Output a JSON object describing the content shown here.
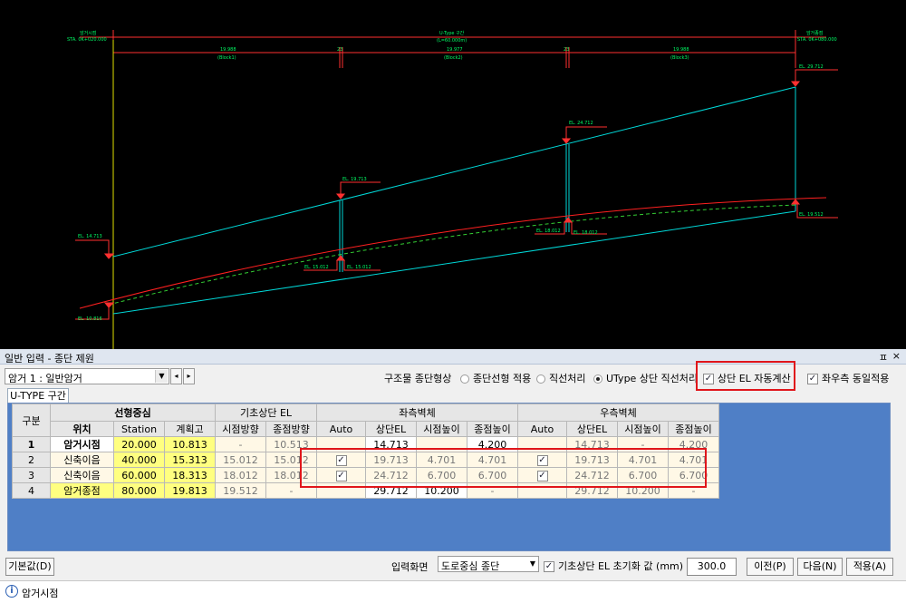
{
  "cad": {
    "start_title": "암거시점",
    "start_sta": "STA. 0K+020.000",
    "end_title": "암거종점",
    "end_sta": "STA. 0K+080.000",
    "span_title": "U-Type 구간",
    "span_length": "(L=60.000m)",
    "dims": [
      {
        "value": "19.988",
        "label": "(Block1)"
      },
      {
        "value": "23",
        "label": ""
      },
      {
        "value": "19.977",
        "label": "(Block2)"
      },
      {
        "value": "23",
        "label": ""
      },
      {
        "value": "19.988",
        "label": "(Block3)"
      }
    ],
    "el_labels": {
      "start_top": "EL. 14.713",
      "start_bottom": "EL. 10.816",
      "p1_top": "EL. 19.713",
      "p1_bottom_left": "EL. 15.012",
      "p1_bottom_right": "EL. 15.012",
      "p2_top": "EL. 24.712",
      "p2_bottom_left": "EL. 18.012",
      "p2_bottom_right": "EL. 18.012",
      "end_top": "EL. 29.712",
      "end_bottom": "EL. 19.512"
    },
    "colors": {
      "structure": "#00d8d8",
      "road": "#ff2020",
      "base": "#33cc33",
      "axis": "#e0e000",
      "dim": "#ff3030",
      "text": "#00ff66"
    }
  },
  "panel": {
    "title": "일반 입력 - 종단 제원",
    "pin": "ㅍ",
    "close": "×",
    "culvert_select": "암거 1 : 일반암거",
    "shape_label": "구조물 종단형상",
    "radio1": "종단선형 적용",
    "radio2": "직선처리",
    "radio3": "UType 상단 직선처리",
    "auto_calc": "상단 EL 자동계산",
    "both_sides": "좌우측 동일적용",
    "tab": "U-TYPE 구간"
  },
  "grid": {
    "header1": {
      "gubun": "구분",
      "center": "선형중심",
      "base": "기초상단 EL",
      "left": "좌측벽체",
      "right": "우측벽체"
    },
    "header2": [
      "위치",
      "Station",
      "계획고",
      "시점방향",
      "종점방향",
      "Auto",
      "상단EL",
      "시점높이",
      "종점높이",
      "Auto",
      "상단EL",
      "시점높이",
      "종점높이"
    ],
    "rows": [
      {
        "no": "1",
        "pos": "암거시점",
        "station": "20.000",
        "plan": "10.813",
        "b_start": "-",
        "b_end": "10.513",
        "l_auto": false,
        "l_top": "14.713",
        "l_sh": "",
        "l_eh": "4.200",
        "r_auto": false,
        "r_top": "14.713",
        "r_sh": "-",
        "r_eh": "4.200"
      },
      {
        "no": "2",
        "pos": "신축이음",
        "station": "40.000",
        "plan": "15.313",
        "b_start": "15.012",
        "b_end": "15.012",
        "l_auto": true,
        "l_top": "19.713",
        "l_sh": "4.701",
        "l_eh": "4.701",
        "r_auto": true,
        "r_top": "19.713",
        "r_sh": "4.701",
        "r_eh": "4.701"
      },
      {
        "no": "3",
        "pos": "신축이음",
        "station": "60.000",
        "plan": "18.313",
        "b_start": "18.012",
        "b_end": "18.012",
        "l_auto": true,
        "l_top": "24.712",
        "l_sh": "6.700",
        "l_eh": "6.700",
        "r_auto": true,
        "r_top": "24.712",
        "r_sh": "6.700",
        "r_eh": "6.700"
      },
      {
        "no": "4",
        "pos": "암거종점",
        "station": "80.000",
        "plan": "19.813",
        "b_start": "19.512",
        "b_end": "-",
        "l_auto": false,
        "l_top": "29.712",
        "l_sh": "10.200",
        "l_eh": "-",
        "r_auto": false,
        "r_top": "29.712",
        "r_sh": "10.200",
        "r_eh": "-"
      }
    ]
  },
  "footer": {
    "default_btn": "기본값(D)",
    "input_screen_label": "입력화면",
    "input_screen_value": "도로중심 종단",
    "reset_label": "기초상단 EL 초기화 값 (mm)",
    "reset_value": "300.0",
    "prev_btn": "이전(P)",
    "next_btn": "다음(N)",
    "apply_btn": "적용(A)",
    "status": "암거시점"
  }
}
